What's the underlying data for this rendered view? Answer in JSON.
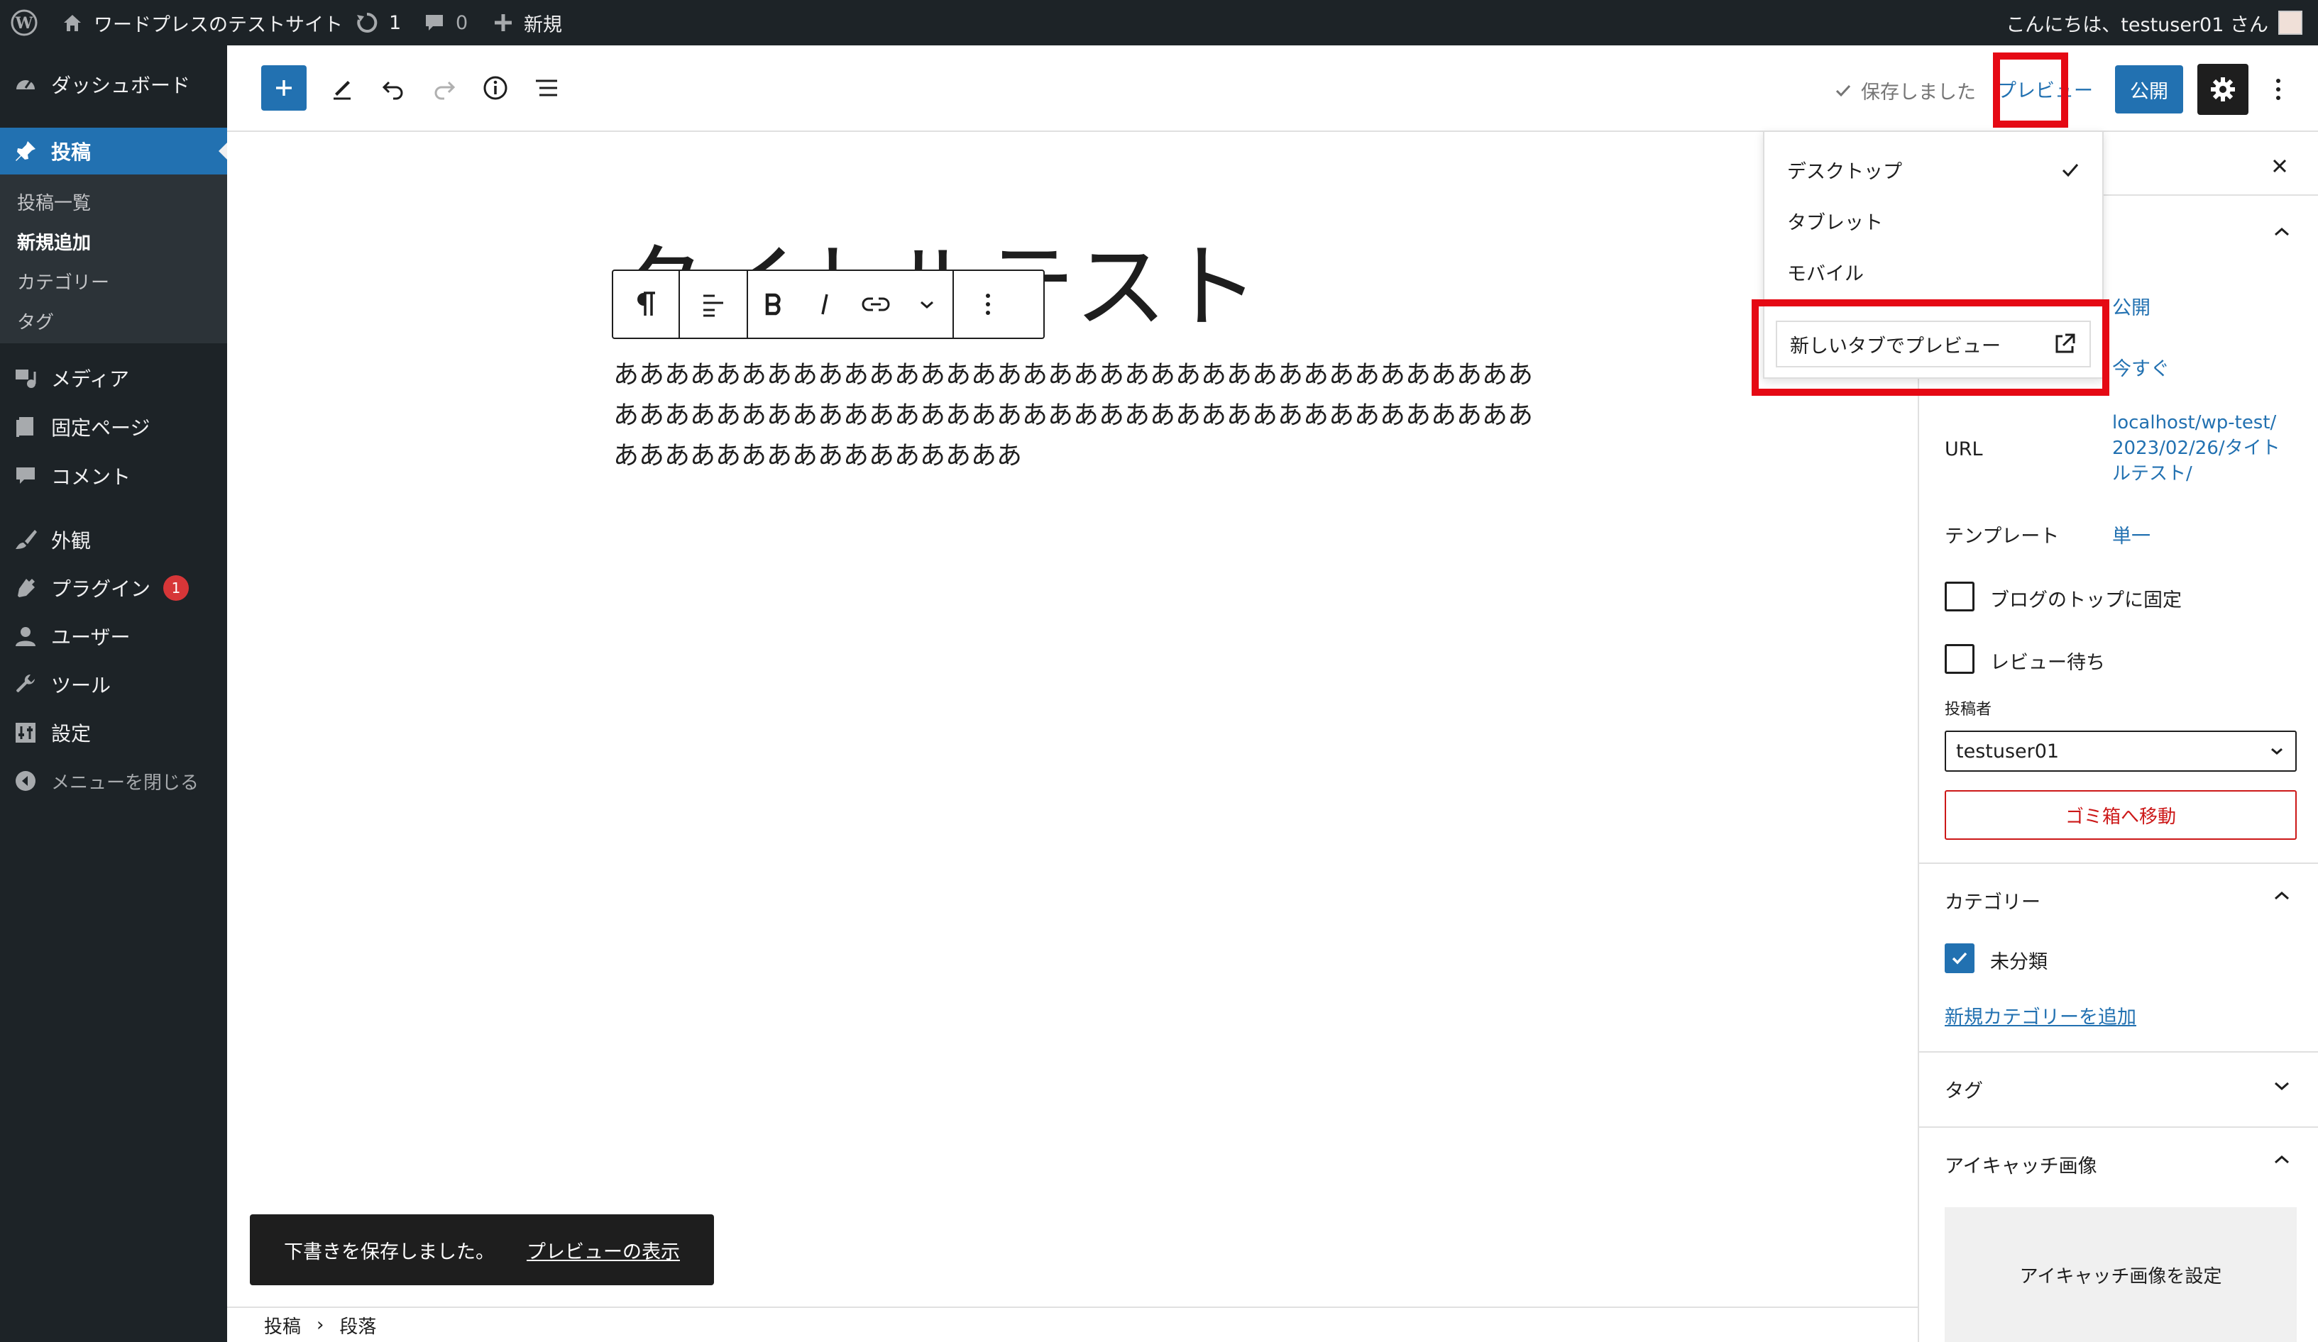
{
  "admin_bar": {
    "site_name": "ワードプレスのテストサイト",
    "updates_count": "1",
    "comments_count": "0",
    "new_label": "新規",
    "greeting": "こんにちは、testuser01 さん"
  },
  "sidebar": {
    "dashboard": "ダッシュボード",
    "posts": "投稿",
    "submenu": [
      "投稿一覧",
      "新規追加",
      "カテゴリー",
      "タグ"
    ],
    "media": "メディア",
    "pages": "固定ページ",
    "comments": "コメント",
    "appearance": "外観",
    "plugins": "プラグイン",
    "plugins_badge": "1",
    "users": "ユーザー",
    "tools": "ツール",
    "settings": "設定",
    "collapse": "メニューを閉じる"
  },
  "header": {
    "saved_status": "保存しました",
    "preview_label": "プレビュー",
    "publish_label": "公開"
  },
  "preview_menu": {
    "desktop": "デスクトップ",
    "tablet": "タブレット",
    "mobile": "モバイル",
    "new_tab": "新しいタブでプレビュー"
  },
  "post": {
    "title": "タイトルテスト",
    "paragraph": "ああああああああああああああああああああああああああああああああああああああああああああああああああああああああああああああああああああああああああああああああああああああああ"
  },
  "snackbar": {
    "message": "下書きを保存しました。",
    "action": "プレビューの表示"
  },
  "breadcrumb": {
    "root": "投稿",
    "separator": "›",
    "current": "段落"
  },
  "panel": {
    "visibility_value": "公開",
    "publish_value": "今すぐ",
    "url_label": "URL",
    "url_value": "localhost/wp-test/2023/02/26/タイトルテスト/",
    "template_label": "テンプレート",
    "template_value": "単一",
    "sticky_label": "ブログのトップに固定",
    "pending_label": "レビュー待ち",
    "author_label": "投稿者",
    "author_value": "testuser01",
    "trash_label": "ゴミ箱へ移動",
    "categories_title": "カテゴリー",
    "category_uncategorized": "未分類",
    "add_category": "新規カテゴリーを追加",
    "tags_title": "タグ",
    "featured_title": "アイキャッチ画像",
    "featured_button": "アイキャッチ画像を設定"
  },
  "colors": {
    "accent": "#2271b1",
    "highlight_box": "#e50914",
    "admin_dark": "#1d2327",
    "danger": "#cc1818"
  }
}
